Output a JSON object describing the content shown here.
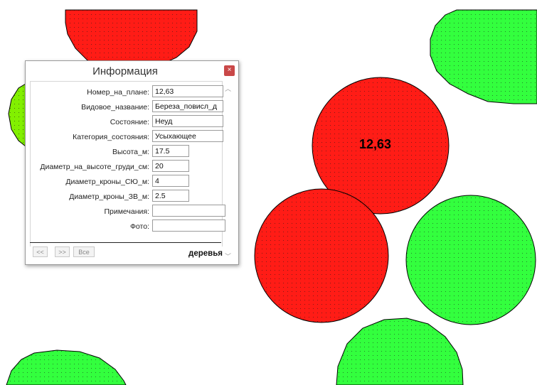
{
  "map": {
    "feature_label": "12,63",
    "colors": {
      "red_crown": "#ff1c16",
      "green_crown": "#33ff3e",
      "lime_crown": "#82f000",
      "outline": "#000000"
    }
  },
  "info_window": {
    "title": "Информация",
    "close_icon": "×",
    "fields": [
      {
        "label": "Номер_на_плане:",
        "value": "12,63"
      },
      {
        "label": "Видовое_название:",
        "value": "Береза_повисл_д"
      },
      {
        "label": "Состояние:",
        "value": "Неуд"
      },
      {
        "label": "Категория_состояния:",
        "value": "Усыхающее"
      },
      {
        "label": "Высота_м:",
        "value": "17.5"
      },
      {
        "label": "Диаметр_на_высоте_груди_см:",
        "value": "20"
      },
      {
        "label": "Диаметр_кроны_СЮ_м:",
        "value": "4"
      },
      {
        "label": "Диаметр_кроны_ЗВ_м:",
        "value": "2.5"
      },
      {
        "label": "Примечания:",
        "value": ""
      },
      {
        "label": "Фото:",
        "value": ""
      }
    ],
    "nav": {
      "prev": "<<",
      "next": ">>",
      "all": "Все"
    },
    "layer_name": "деревья"
  }
}
